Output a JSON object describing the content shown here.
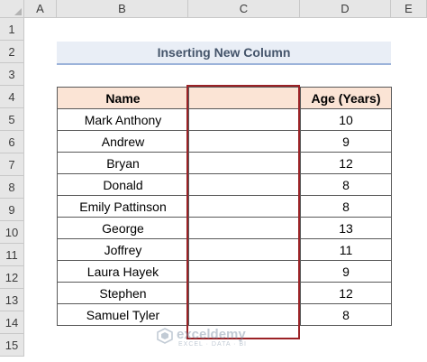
{
  "columns": [
    "A",
    "B",
    "C",
    "D",
    "E"
  ],
  "rows": [
    "1",
    "2",
    "3",
    "4",
    "5",
    "6",
    "7",
    "8",
    "9",
    "10",
    "11",
    "12",
    "13",
    "14",
    "15"
  ],
  "title": "Inserting New Column",
  "table": {
    "headers": {
      "name": "Name",
      "new_column": "",
      "age": "Age (Years)"
    },
    "rows": [
      {
        "name": "Mark Anthony",
        "age": "10"
      },
      {
        "name": "Andrew",
        "age": "9"
      },
      {
        "name": "Bryan",
        "age": "12"
      },
      {
        "name": "Donald",
        "age": "8"
      },
      {
        "name": "Emily Pattinson",
        "age": "8"
      },
      {
        "name": "George",
        "age": "13"
      },
      {
        "name": "Joffrey",
        "age": "11"
      },
      {
        "name": "Laura Hayek",
        "age": "9"
      },
      {
        "name": "Stephen",
        "age": "12"
      },
      {
        "name": "Samuel Tyler",
        "age": "8"
      }
    ]
  },
  "watermark": {
    "brand": "exceldemy",
    "tagline": "EXCEL · DATA · BI"
  },
  "colors": {
    "header_fill": "#fbe4d5",
    "outline": "#9b2226",
    "title_text": "#44546a"
  }
}
